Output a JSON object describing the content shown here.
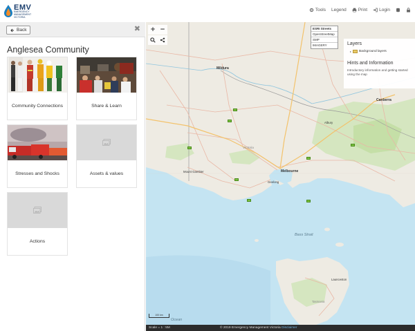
{
  "header": {
    "logo_text": "EMV",
    "logo_sub": "EMERGENCY MANAGEMENT VICTORIA",
    "toolbar": {
      "tools": "Tools",
      "legend": "Legend",
      "print": "Print",
      "login": "Login"
    }
  },
  "panel": {
    "back_label": "Back",
    "close_glyph": "✖",
    "title": "Anglesea Community",
    "cards": [
      {
        "label": "Community Connections"
      },
      {
        "label": "Share & Learn"
      },
      {
        "label": "Stresses and Shocks"
      },
      {
        "label": "Assets & values"
      },
      {
        "label": "Actions"
      }
    ]
  },
  "map": {
    "zoom_in": "+",
    "zoom_out": "−",
    "basemaps": [
      "ESRI Streets",
      "OpenStreetMap",
      "SMP",
      "IMAGERY"
    ],
    "basemap_selected": "ESRI Streets",
    "layers_title": "Layers",
    "layer_item": "Background layers",
    "hints_title": "Hints and Information",
    "hints_text": "Introductory information and getting started using the map",
    "scalebar_label": "100 km",
    "ocean_labels": [
      "Bass Strait",
      "Ocean"
    ],
    "places": [
      {
        "name": "Mildura"
      },
      {
        "name": "Canberra"
      },
      {
        "name": "Albury"
      },
      {
        "name": "Victoria"
      },
      {
        "name": "Mount Gambier"
      },
      {
        "name": "Melbourne"
      },
      {
        "name": "Geelong"
      },
      {
        "name": "Launceston"
      },
      {
        "name": "Tasmania"
      }
    ]
  },
  "footer": {
    "scale": "Scale = 1 : 5M",
    "copyright": "© 2019 Emergency Management Victoria",
    "disclaimer": "Disclaimer"
  },
  "colors": {
    "land": "#eeebe3",
    "water": "#c4e4f2",
    "road": "#e9b7a5",
    "highway": "#f3c26b",
    "park": "#c5dfa7",
    "header_text": "#1c3f6e"
  },
  "icons": [
    "logo-drop-icon",
    "gear-icon",
    "printer-icon",
    "login-icon",
    "database-icon",
    "lock-icon",
    "search-icon",
    "share-icon",
    "image-placeholder-icon",
    "folder-icon"
  ]
}
